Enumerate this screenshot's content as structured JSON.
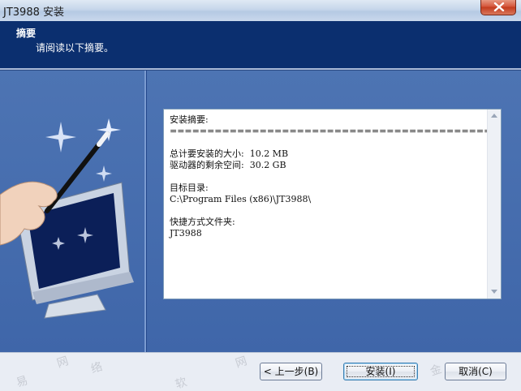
{
  "window": {
    "title": "JT3988 安装"
  },
  "header": {
    "title": "摘要",
    "subtitle": "请阅读以下摘要。"
  },
  "summary": {
    "heading": "安装摘要:",
    "divider": "===========================================",
    "size_line": "总计要安装的大小:  10.2 MB",
    "space_line": "驱动器的剩余空间:  30.2 GB",
    "target_label": "目标目录:",
    "target_path": "C:\\Program Files (x86)\\JT3988\\",
    "shortcut_label": "快捷方式文件夹:",
    "shortcut_value": "JT3988"
  },
  "buttons": {
    "back": "< 上一步(B)",
    "install": "安装(I)",
    "cancel": "取消(C)"
  },
  "watermark": {
    "chars": [
      "网",
      "络",
      "金",
      "易",
      "软"
    ]
  },
  "colors": {
    "header_bg": "#0b2f6f",
    "body_bg": "#4b71b0",
    "close_button": "#c9452a"
  }
}
